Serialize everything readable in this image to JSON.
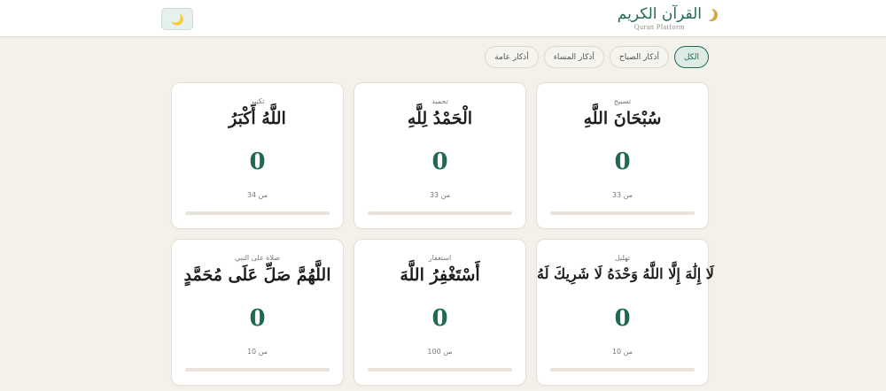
{
  "header": {
    "brand_title": "القرآن الكريم",
    "brand_subtitle": "Quran Platform",
    "theme_icon": "moon-icon",
    "theme_glyph": "🌙"
  },
  "filters": [
    {
      "label": "الكل",
      "active": true
    },
    {
      "label": "أذكار الصباح",
      "active": false
    },
    {
      "label": "أذكار المساء",
      "active": false
    },
    {
      "label": "أذكار عامة",
      "active": false
    }
  ],
  "cards": [
    {
      "label": "تسبيح",
      "text": "سُبْحَانَ اللَّهِ",
      "count": "0",
      "target": "من 33",
      "progress": 0
    },
    {
      "label": "تحميد",
      "text": "الْحَمْدُ لِلَّهِ",
      "count": "0",
      "target": "من 33",
      "progress": 0
    },
    {
      "label": "تكبير",
      "text": "اللَّهُ أَكْبَرُ",
      "count": "0",
      "target": "من 34",
      "progress": 0
    },
    {
      "label": "تهليل",
      "text": "لَا إِلَٰهَ إِلَّا اللَّهُ وَحْدَهُ لَا شَرِيكَ لَهُ",
      "count": "0",
      "target": "من 10",
      "progress": 0
    },
    {
      "label": "استغفار",
      "text": "أَسْتَغْفِرُ اللَّهَ",
      "count": "0",
      "target": "من 100",
      "progress": 0
    },
    {
      "label": "صلاة على النبي",
      "text": "اللَّهُمَّ صَلِّ عَلَى مُحَمَّدٍ",
      "count": "0",
      "target": "من 10",
      "progress": 0
    }
  ],
  "colors": {
    "accent": "#1f6b4f",
    "background": "#f3f1ea",
    "gold": "#d4a64a"
  }
}
